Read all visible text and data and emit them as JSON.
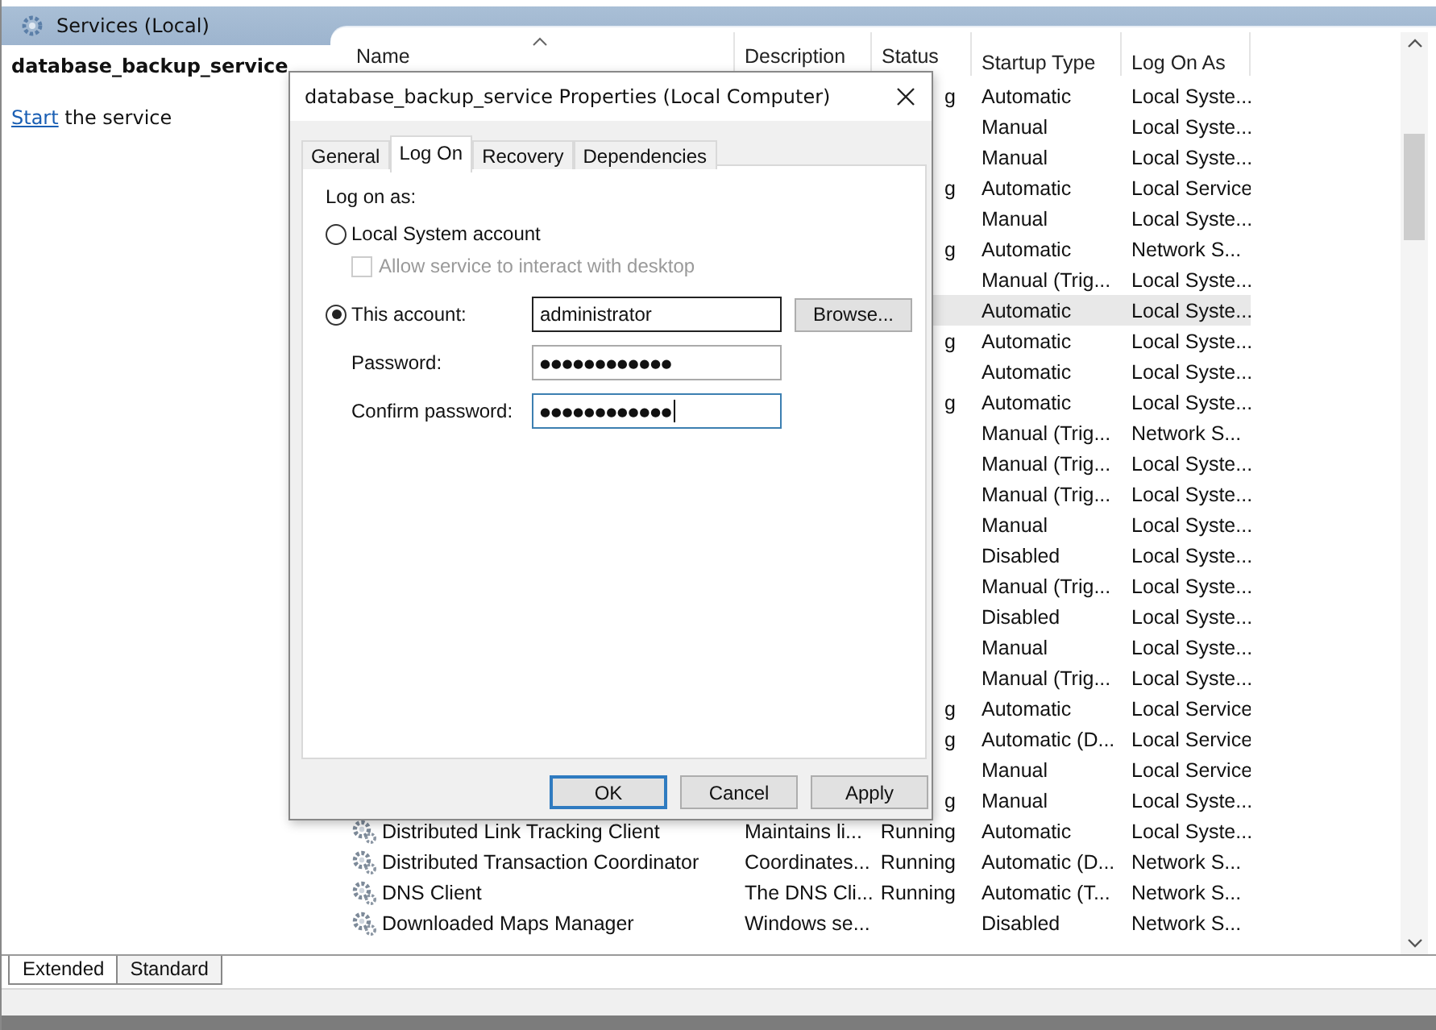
{
  "header": {
    "title": "Services (Local)"
  },
  "left_panel": {
    "service_name": "database_backup_service",
    "action_link": "Start",
    "action_text": " the service"
  },
  "table": {
    "columns": [
      {
        "label": "Name",
        "sorted": true
      },
      {
        "label": "Description",
        "sorted": false
      },
      {
        "label": "Status",
        "sorted": false
      },
      {
        "label": "Startup Type",
        "sorted": false
      },
      {
        "label": "Log On As",
        "sorted": false
      }
    ],
    "rows": [
      {
        "status": "g",
        "startup": "Automatic",
        "logon": "Local Syste...",
        "selected": false
      },
      {
        "startup": "Manual",
        "logon": "Local Syste...",
        "selected": false
      },
      {
        "startup": "Manual",
        "logon": "Local Syste...",
        "selected": false
      },
      {
        "status": "g",
        "startup": "Automatic",
        "logon": "Local Service",
        "selected": false
      },
      {
        "startup": "Manual",
        "logon": "Local Syste...",
        "selected": false
      },
      {
        "status": "g",
        "startup": "Automatic",
        "logon": "Network S...",
        "selected": false
      },
      {
        "startup": "Manual (Trig...",
        "logon": "Local Syste...",
        "selected": false
      },
      {
        "startup": "Automatic",
        "logon": "Local Syste...",
        "selected": true
      },
      {
        "status": "g",
        "startup": "Automatic",
        "logon": "Local Syste...",
        "selected": false
      },
      {
        "startup": "Automatic",
        "logon": "Local Syste...",
        "selected": false
      },
      {
        "status": "g",
        "startup": "Automatic",
        "logon": "Local Syste...",
        "selected": false
      },
      {
        "startup": "Manual (Trig...",
        "logon": "Network S...",
        "selected": false
      },
      {
        "startup": "Manual (Trig...",
        "logon": "Local Syste...",
        "selected": false
      },
      {
        "startup": "Manual (Trig...",
        "logon": "Local Syste...",
        "selected": false
      },
      {
        "startup": "Manual",
        "logon": "Local Syste...",
        "selected": false
      },
      {
        "startup": "Disabled",
        "logon": "Local Syste...",
        "selected": false
      },
      {
        "startup": "Manual (Trig...",
        "logon": "Local Syste...",
        "selected": false
      },
      {
        "startup": "Disabled",
        "logon": "Local Syste...",
        "selected": false
      },
      {
        "startup": "Manual",
        "logon": "Local Syste...",
        "selected": false
      },
      {
        "startup": "Manual (Trig...",
        "logon": "Local Syste...",
        "selected": false
      },
      {
        "status": "g",
        "startup": "Automatic",
        "logon": "Local Service",
        "selected": false
      },
      {
        "status": "g",
        "startup": "Automatic (D...",
        "logon": "Local Service",
        "selected": false
      },
      {
        "startup": "Manual",
        "logon": "Local Service",
        "selected": false
      },
      {
        "status": "g",
        "startup": "Manual",
        "logon": "Local Syste...",
        "selected": false
      },
      {
        "name": "Distributed Link Tracking Client",
        "description": "Maintains li...",
        "status": "Running",
        "startup": "Automatic",
        "logon": "Local Syste...",
        "selected": false
      },
      {
        "name": "Distributed Transaction Coordinator",
        "description": "Coordinates...",
        "status": "Running",
        "startup": "Automatic (D...",
        "logon": "Network S...",
        "selected": false
      },
      {
        "name": "DNS Client",
        "description": "The DNS Cli...",
        "status": "Running",
        "startup": "Automatic (T...",
        "logon": "Network S...",
        "selected": false
      },
      {
        "name": "Downloaded Maps Manager",
        "description": "Windows se...",
        "startup": "Disabled",
        "logon": "Network S...",
        "selected": false
      }
    ]
  },
  "view_tabs": [
    {
      "label": "Extended",
      "selected": true
    },
    {
      "label": "Standard",
      "selected": false
    }
  ],
  "dialog": {
    "title": "database_backup_service Properties (Local Computer)",
    "tabs": [
      {
        "label": "General",
        "selected": false
      },
      {
        "label": "Log On",
        "selected": true
      },
      {
        "label": "Recovery",
        "selected": false
      },
      {
        "label": "Dependencies",
        "selected": false
      }
    ],
    "log_on_label": "Log on as:",
    "options": [
      {
        "label": "Local System account",
        "selected": false
      },
      {
        "label": "This account:",
        "selected": true
      }
    ],
    "interact_checkbox": {
      "label": "Allow service to interact with desktop",
      "checked": false,
      "disabled": true
    },
    "account": {
      "value": "administrator"
    },
    "browse": "Browse...",
    "password": {
      "label": "Password:",
      "value": "●●●●●●●●●●●●",
      "focused": false
    },
    "confirm": {
      "label": "Confirm password:",
      "value": "●●●●●●●●●●●●",
      "focused": true
    },
    "buttons": [
      {
        "label": "OK",
        "default": true
      },
      {
        "label": "Cancel",
        "default": false
      },
      {
        "label": "Apply",
        "default": false
      }
    ]
  }
}
